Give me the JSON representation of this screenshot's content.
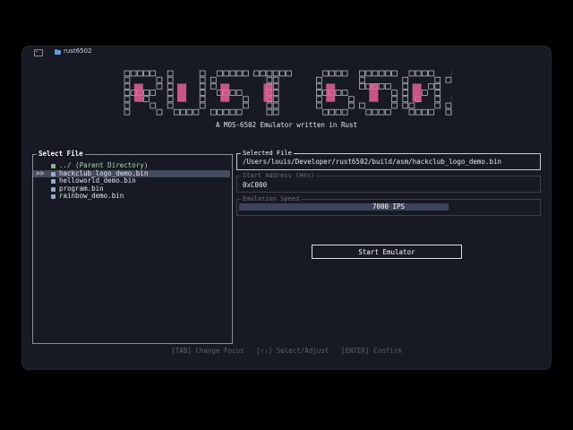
{
  "titlebar": {
    "tab_title": "rust6502"
  },
  "banner": {
    "logo_text": "RUST 6502",
    "accent_color": "#e8609a",
    "subtitle": "A MOS-6502 Emulator written in Rust"
  },
  "file_browser": {
    "title": "Select File",
    "selected_marker": ">>",
    "items": [
      {
        "name": "../ (Parent Directory)",
        "type": "folder",
        "selected": false
      },
      {
        "name": "hackclub_logo_demo.bin",
        "type": "file",
        "selected": true
      },
      {
        "name": "helloworld_demo.bin",
        "type": "file",
        "selected": false
      },
      {
        "name": "program.bin",
        "type": "file",
        "selected": false
      },
      {
        "name": "rainbow_demo.bin",
        "type": "file",
        "selected": false
      }
    ]
  },
  "selected_file": {
    "label": "Selected File",
    "value": "/Users/louis/Developer/rust6502/build/asm/hackclub_logo_demo.bin"
  },
  "start_address": {
    "label": "Start Address (Hex)",
    "value": "0xC000"
  },
  "emulation_speed": {
    "label": "Emulation Speed",
    "value_text": "7000 IPS",
    "fill_fraction": 0.7
  },
  "start_button": {
    "label": "Start Emulator"
  },
  "help": {
    "text": "[TAB] Change Focus   [↑↓] Select/Adjust   [ENTER] Confirm"
  }
}
